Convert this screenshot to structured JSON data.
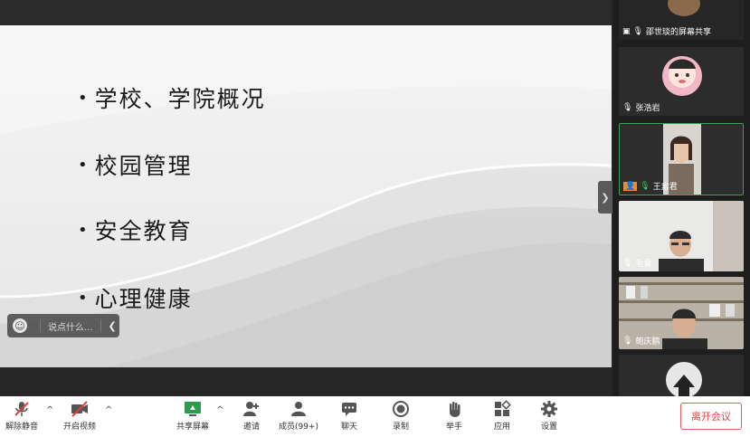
{
  "slide": {
    "bullets": [
      "学校、学院概况",
      "校园管理",
      "安全教育",
      "心理健康"
    ]
  },
  "chat": {
    "placeholder": "说点什么..."
  },
  "gallery": {
    "tiles": [
      {
        "name": "邵世琰的屏幕共享"
      },
      {
        "name": "张浩岩"
      },
      {
        "name": "王素君"
      },
      {
        "name": "毛雷"
      },
      {
        "name": "鲍庆鹏"
      },
      {
        "name": ""
      }
    ]
  },
  "toolbar": {
    "unmute": "解除静音",
    "start_video": "开启视频",
    "share_screen": "共享屏幕",
    "invite": "邀请",
    "members": "成员(99+)",
    "chat": "聊天",
    "record": "录制",
    "raise_hand": "举手",
    "apps": "应用",
    "settings": "设置",
    "leave": "离开会议"
  },
  "colors": {
    "accent_green": "#3aa05a",
    "leave_red": "#e04848"
  }
}
